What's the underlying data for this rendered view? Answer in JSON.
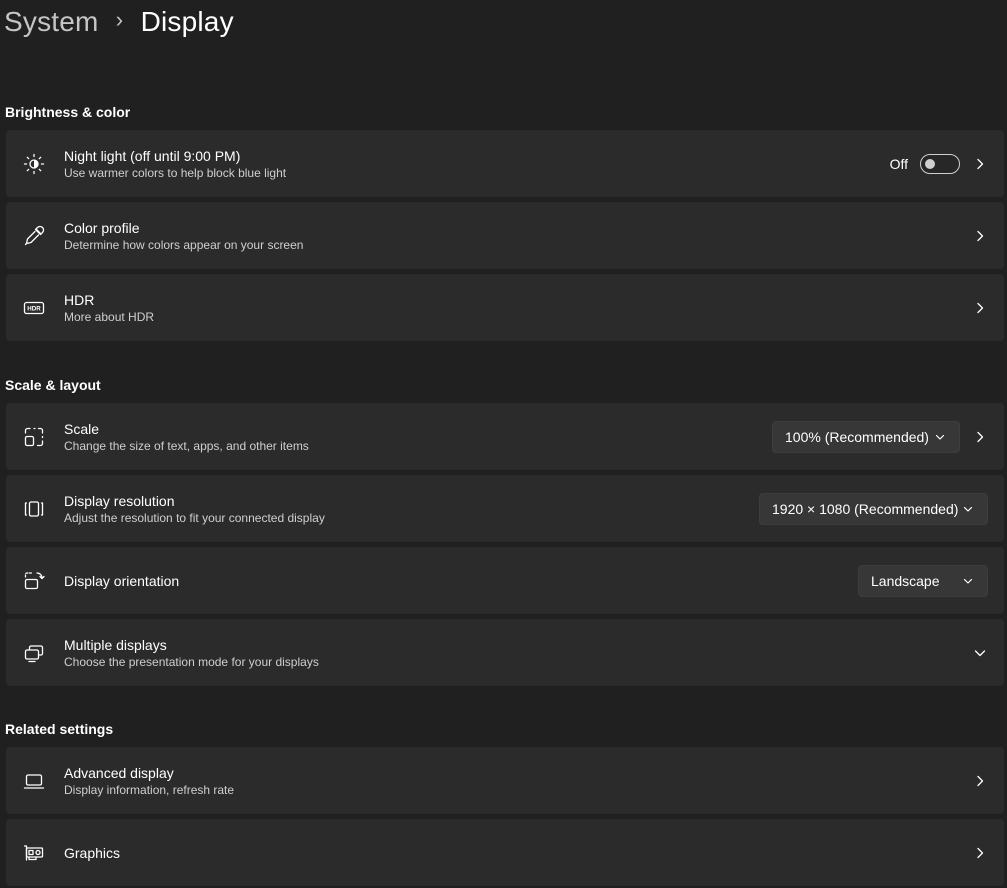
{
  "breadcrumb": {
    "parent": "System",
    "separator": "›",
    "current": "Display"
  },
  "sections": {
    "brightness": "Brightness & color",
    "scale": "Scale & layout",
    "related": "Related settings"
  },
  "night_light": {
    "title": "Night light (off until 9:00 PM)",
    "subtitle": "Use warmer colors to help block blue light",
    "toggle_label": "Off",
    "toggle_on": false,
    "icon": "brightness-sun-icon"
  },
  "color_profile": {
    "title": "Color profile",
    "subtitle": "Determine how colors appear on your screen",
    "icon": "eyedropper-icon"
  },
  "hdr": {
    "title": "HDR",
    "subtitle": "More about HDR",
    "icon_text": "HDR",
    "icon": "hdr-icon"
  },
  "scale": {
    "title": "Scale",
    "subtitle": "Change the size of text, apps, and other items",
    "value": "100% (Recommended)",
    "icon": "scale-icon"
  },
  "resolution": {
    "title": "Display resolution",
    "subtitle": "Adjust the resolution to fit your connected display",
    "value": "1920 × 1080 (Recommended)",
    "icon": "resolution-icon"
  },
  "orientation": {
    "title": "Display orientation",
    "value": "Landscape",
    "icon": "orientation-icon"
  },
  "multiple_displays": {
    "title": "Multiple displays",
    "subtitle": "Choose the presentation mode for your displays",
    "icon": "multiple-displays-icon"
  },
  "advanced_display": {
    "title": "Advanced display",
    "subtitle": "Display information, refresh rate",
    "icon": "laptop-icon"
  },
  "graphics": {
    "title": "Graphics",
    "icon": "graphics-card-icon"
  },
  "colors": {
    "background": "#202020",
    "card": "#2b2b2b",
    "dropdown": "#373737",
    "secondary_text": "#cfcfcf"
  }
}
